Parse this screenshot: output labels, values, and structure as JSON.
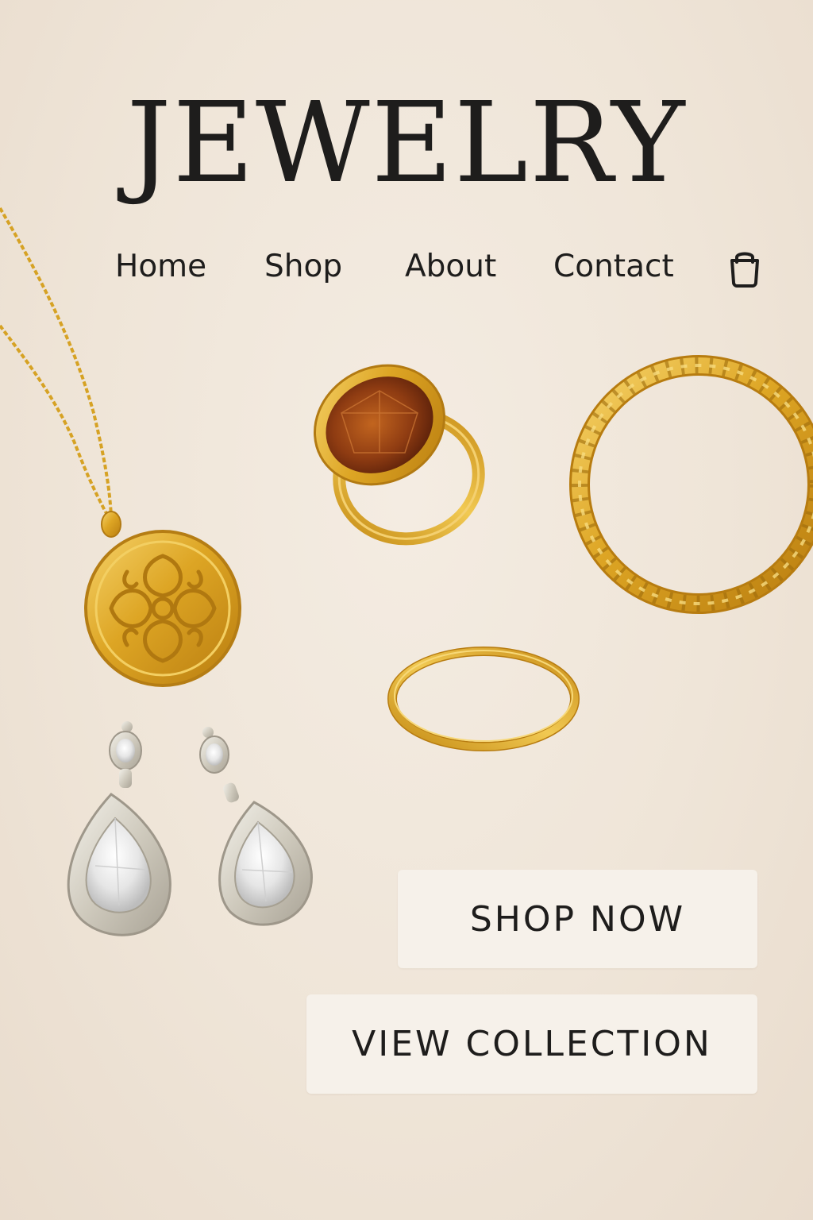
{
  "header": {
    "title": "JEWELRY"
  },
  "nav": {
    "items": [
      {
        "label": "Home"
      },
      {
        "label": "Shop"
      },
      {
        "label": "About"
      },
      {
        "label": "Contact"
      }
    ],
    "cart_icon": "shopping-bag-icon"
  },
  "products": {
    "items": [
      "necklace",
      "gemstone-ring",
      "twisted-bangle",
      "plain-band-ring",
      "drop-earrings"
    ]
  },
  "actions": {
    "shop_now_label": "SHOP NOW",
    "view_collection_label": "VIEW COLLECTION"
  },
  "colors": {
    "background": "#efe5d8",
    "text": "#1e1d1c",
    "gold": "#d9a520",
    "gem": "#8a3b14",
    "button_bg": "#f6f1ea"
  }
}
